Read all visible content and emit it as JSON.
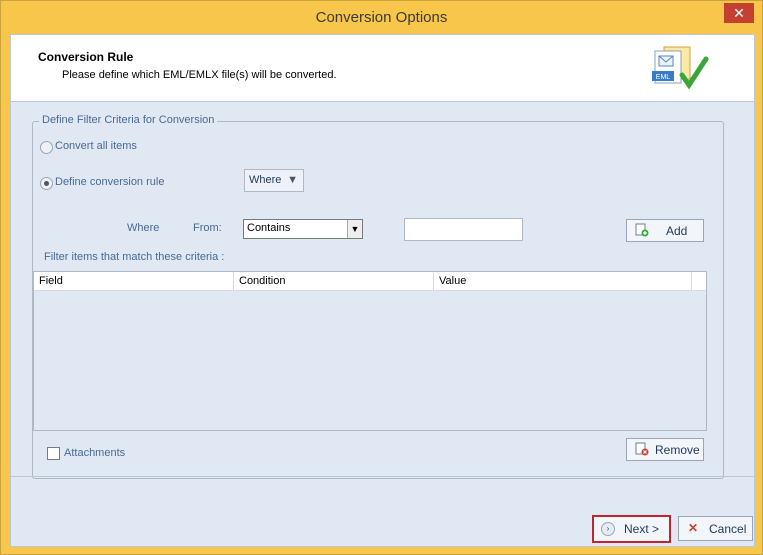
{
  "window": {
    "title": "Conversion Options",
    "close_glyph": "✕"
  },
  "header": {
    "title": "Conversion Rule",
    "subtitle": "Please define which EML/EMLX file(s) will be converted.",
    "logo_text": "EML",
    "logo_icon": "eml-file-check-icon"
  },
  "filter": {
    "legend": "Define Filter Criteria for Conversion",
    "option_all": "Convert all items",
    "option_rule": "Define conversion rule",
    "selected_option": "Define conversion rule",
    "where_dropdown": "Where",
    "where_label": "Where",
    "from_label": "From:",
    "condition_value": "Contains",
    "text_value": "",
    "add_label": "Add",
    "match_label": "Filter items that match these criteria :"
  },
  "grid": {
    "columns": [
      "Field",
      "Condition",
      "Value"
    ],
    "rows": []
  },
  "bottom": {
    "attachments_label": "Attachments",
    "attachments_checked": false,
    "remove_label": "Remove"
  },
  "footer": {
    "next_label": "Next >",
    "cancel_label": "Cancel"
  },
  "colors": {
    "frame": "#f7c64a",
    "panel": "#dfe8f3",
    "close": "#c44131",
    "focus_outline": "#c0262e"
  }
}
